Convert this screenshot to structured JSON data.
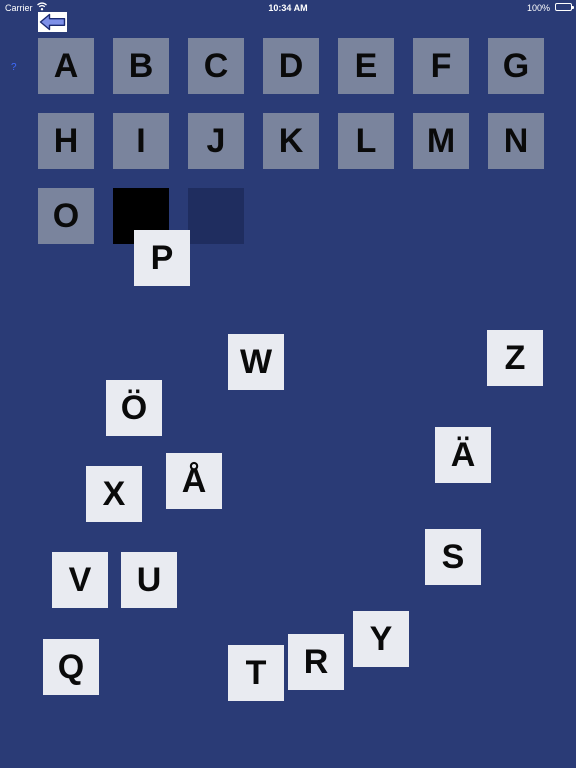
{
  "status_bar": {
    "carrier": "Carrier",
    "time": "10:34 AM",
    "battery": "100%"
  },
  "toolbar": {
    "back_icon": "left-arrow-icon",
    "help_label": "?"
  },
  "colors": {
    "background": "#2a3b76",
    "placed_tile": "#7a849d",
    "loose_tile": "#e9ebf1",
    "active_slot": "#000000",
    "empty_slot": "#1f2d5f"
  },
  "alphabet_grid": {
    "placed": [
      "A",
      "B",
      "C",
      "D",
      "E",
      "F",
      "G",
      "H",
      "I",
      "J",
      "K",
      "L",
      "M",
      "N",
      "O"
    ]
  },
  "loose_tiles": [
    "P",
    "W",
    "Z",
    "Ö",
    "Ä",
    "X",
    "Å",
    "S",
    "V",
    "U",
    "Y",
    "Q",
    "R",
    "T"
  ]
}
